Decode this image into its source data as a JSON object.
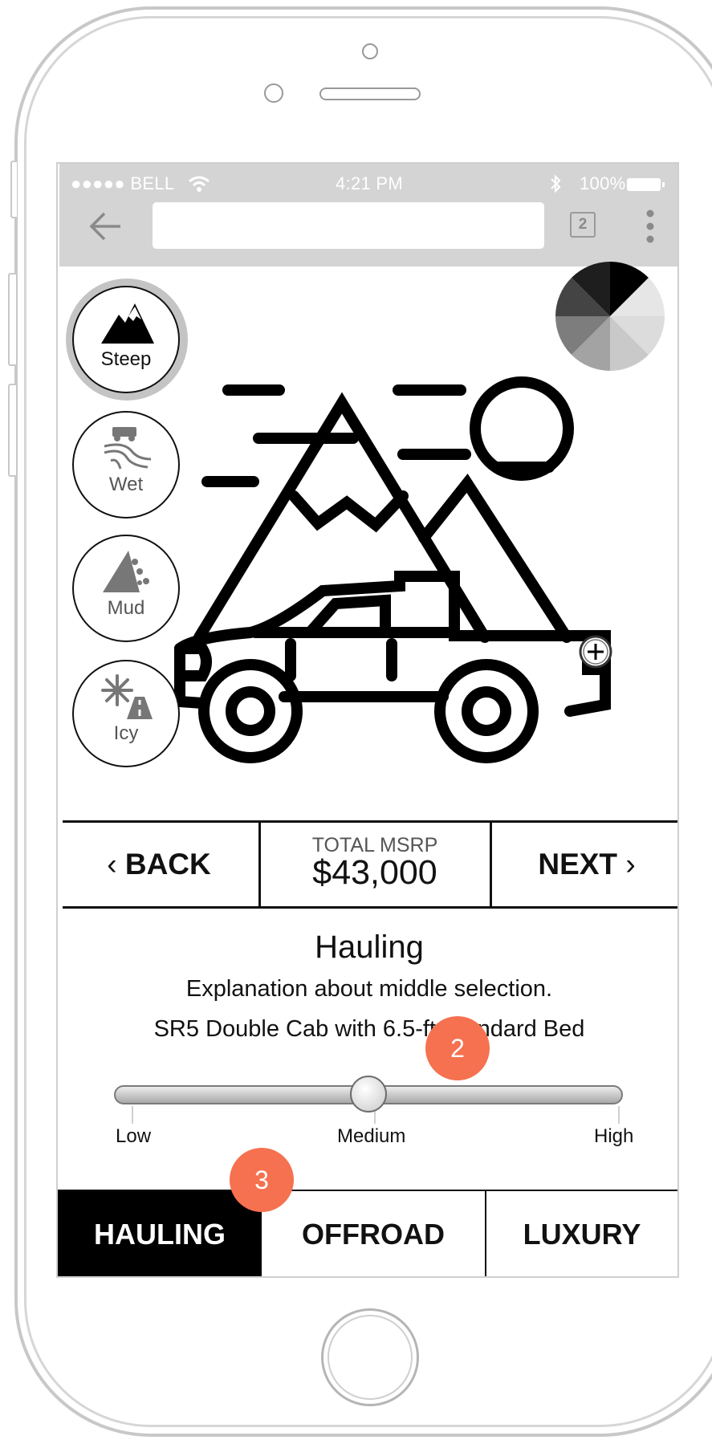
{
  "status_bar": {
    "carrier": "●●●●● BELL",
    "time": "4:21 PM",
    "battery": "100%"
  },
  "browser": {
    "url": "",
    "tab_count": "2"
  },
  "terrain_options": [
    {
      "label": "Steep",
      "icon": "mountain-icon",
      "selected": true
    },
    {
      "label": "Wet",
      "icon": "truck-winding-road-icon",
      "selected": false
    },
    {
      "label": "Mud",
      "icon": "rockslide-icon",
      "selected": false
    },
    {
      "label": "Icy",
      "icon": "snowflake-road-icon",
      "selected": false
    }
  ],
  "hero": {
    "illustration": "truck-mountains-sun-illustration",
    "color_wheel": "color-wheel-icon",
    "hotspot": "add-hotspot-icon"
  },
  "pricing": {
    "back_label": "BACK",
    "next_label": "NEXT",
    "total_label": "TOTAL MSRP",
    "total_value": "$43,000"
  },
  "details": {
    "title": "Hauling",
    "line1": "Explanation about middle selection.",
    "line2": "SR5 Double Cab with 6.5-ft Standard Bed"
  },
  "slider": {
    "labels": [
      "Low",
      "Medium",
      "High"
    ],
    "selected": "Medium",
    "value": 0.5
  },
  "tabs": [
    {
      "label": "HAULING",
      "active": true
    },
    {
      "label": "OFFROAD",
      "active": false
    },
    {
      "label": "LUXURY",
      "active": false
    }
  ],
  "callouts": [
    "2",
    "3"
  ],
  "colors": {
    "callout": "#f5714f",
    "chrome": "#d4d4d4",
    "active_tab": "#000000"
  }
}
